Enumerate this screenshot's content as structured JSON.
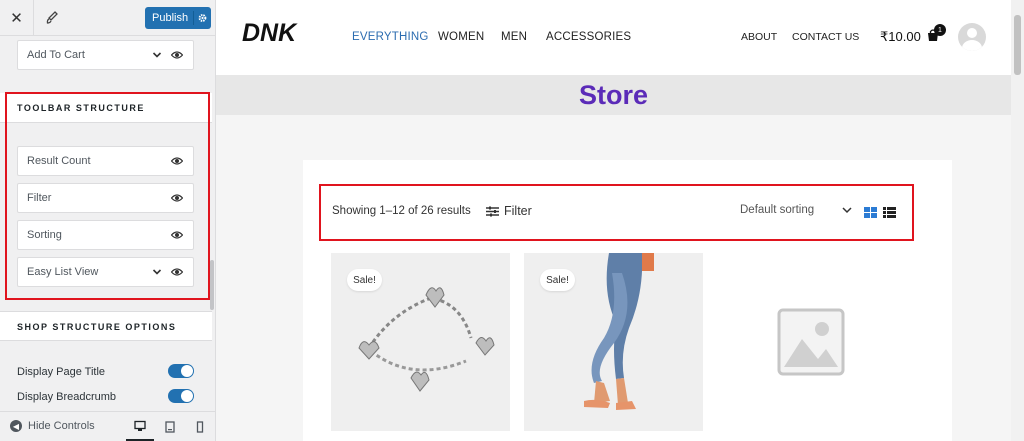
{
  "sidebar": {
    "close_icon": "close-icon",
    "brush_icon": "paint-brush-icon",
    "publish_label": "Publish",
    "add_to_cart": "Add To Cart",
    "toolbar_section_title": "TOOLBAR STRUCTURE",
    "toolbar_items": [
      "Result Count",
      "Filter",
      "Sorting",
      "Easy List View"
    ],
    "shop_section_title": "SHOP STRUCTURE OPTIONS",
    "toggles": [
      {
        "label": "Display Page Title",
        "on": true
      },
      {
        "label": "Display Breadcrumb",
        "on": true
      }
    ],
    "hide_controls": "Hide Controls",
    "accent_color": "#2271b1"
  },
  "header": {
    "logo": "DNK",
    "nav": [
      "EVERYTHING",
      "WOMEN",
      "MEN",
      "ACCESSORIES"
    ],
    "active_nav": "EVERYTHING",
    "nav_right": [
      "ABOUT",
      "CONTACT US"
    ],
    "cart_total": "₹10.00",
    "cart_count": "1"
  },
  "page": {
    "title": "Store",
    "title_color": "#5b2bb8"
  },
  "toolbar": {
    "result_count": "Showing 1–12 of 26 results",
    "filter_label": "Filter",
    "sorting": "Default sorting"
  },
  "products": [
    {
      "badge": "Sale!",
      "image": "silver-heart-bracelet"
    },
    {
      "badge": "Sale!",
      "image": "woman-in-jeans"
    },
    {
      "badge": "",
      "image": "placeholder-image"
    }
  ]
}
